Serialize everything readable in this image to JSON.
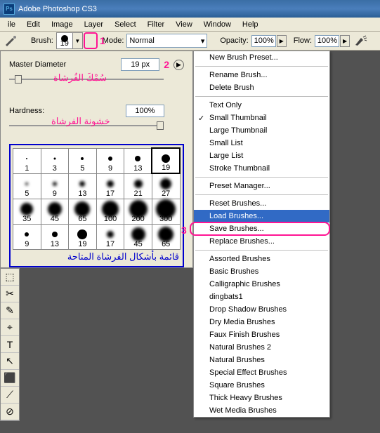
{
  "title": "Adobe Photoshop CS3",
  "menu": [
    "ile",
    "Edit",
    "Image",
    "Layer",
    "Select",
    "Filter",
    "View",
    "Window",
    "Help"
  ],
  "options": {
    "brush_label": "Brush:",
    "brush_size": "19",
    "mode_label": "Mode:",
    "mode_value": "Normal",
    "opacity_label": "Opacity:",
    "opacity_value": "100%",
    "flow_label": "Flow:",
    "flow_value": "100%"
  },
  "mark1": "1",
  "mark2": "2",
  "mark3": "3",
  "panel": {
    "master_label": "Master Diameter",
    "master_value": "19 px",
    "hardness_label": "Hardness:",
    "hardness_value": "100%",
    "arabic_diameter": "سُمْكَ الفُرشاة",
    "arabic_hardness": "خشونة الفرشاة",
    "arabic_grid": "قائمة بأشكال الفرشاة المتاحة"
  },
  "brushes": [
    [
      {
        "n": "1",
        "s": 2
      },
      {
        "n": "3",
        "s": 3
      },
      {
        "n": "5",
        "s": 4
      },
      {
        "n": "9",
        "s": 6
      },
      {
        "n": "13",
        "s": 8
      },
      {
        "n": "19",
        "s": 12,
        "sel": true
      }
    ],
    [
      {
        "n": "5",
        "s": 4,
        "b": 1
      },
      {
        "n": "9",
        "s": 6,
        "b": 1
      },
      {
        "n": "13",
        "s": 8,
        "b": 1
      },
      {
        "n": "17",
        "s": 10,
        "b": 1
      },
      {
        "n": "21",
        "s": 12,
        "b": 1
      },
      {
        "n": "27",
        "s": 16,
        "b": 1
      }
    ],
    [
      {
        "n": "35",
        "s": 18,
        "b": 1
      },
      {
        "n": "45",
        "s": 20,
        "b": 1
      },
      {
        "n": "65",
        "s": 22,
        "b": 1
      },
      {
        "n": "100",
        "s": 24,
        "b": 1
      },
      {
        "n": "200",
        "s": 26,
        "b": 1
      },
      {
        "n": "300",
        "s": 28,
        "b": 1
      }
    ],
    [
      {
        "n": "9",
        "s": 6
      },
      {
        "n": "13",
        "s": 8
      },
      {
        "n": "19",
        "s": 14
      },
      {
        "n": "17",
        "s": 10,
        "b": 1
      },
      {
        "n": "45",
        "s": 20,
        "b": 1
      },
      {
        "n": "65",
        "s": 22,
        "b": 1
      }
    ]
  ],
  "ctx": [
    {
      "t": "New Brush Preset..."
    },
    {
      "sep": 1
    },
    {
      "t": "Rename Brush..."
    },
    {
      "t": "Delete Brush"
    },
    {
      "sep": 1
    },
    {
      "t": "Text Only"
    },
    {
      "t": "Small Thumbnail",
      "check": true
    },
    {
      "t": "Large Thumbnail"
    },
    {
      "t": "Small List"
    },
    {
      "t": "Large List"
    },
    {
      "t": "Stroke Thumbnail"
    },
    {
      "sep": 1
    },
    {
      "t": "Preset Manager..."
    },
    {
      "sep": 1
    },
    {
      "t": "Reset Brushes..."
    },
    {
      "t": "Load Brushes...",
      "hl": true
    },
    {
      "t": "Save Brushes..."
    },
    {
      "t": "Replace Brushes..."
    },
    {
      "sep": 1
    },
    {
      "t": "Assorted Brushes"
    },
    {
      "t": "Basic Brushes"
    },
    {
      "t": "Calligraphic Brushes"
    },
    {
      "t": "dingbats1"
    },
    {
      "t": "Drop Shadow Brushes"
    },
    {
      "t": "Dry Media Brushes"
    },
    {
      "t": "Faux Finish Brushes"
    },
    {
      "t": "Natural Brushes 2"
    },
    {
      "t": "Natural Brushes"
    },
    {
      "t": "Special Effect Brushes"
    },
    {
      "t": "Square Brushes"
    },
    {
      "t": "Thick Heavy Brushes"
    },
    {
      "t": "Wet Media Brushes"
    }
  ],
  "tools": [
    "⬚",
    "✂",
    "✎",
    "⌖",
    "T",
    "↖",
    "⬛",
    "⟋",
    "⊘"
  ]
}
